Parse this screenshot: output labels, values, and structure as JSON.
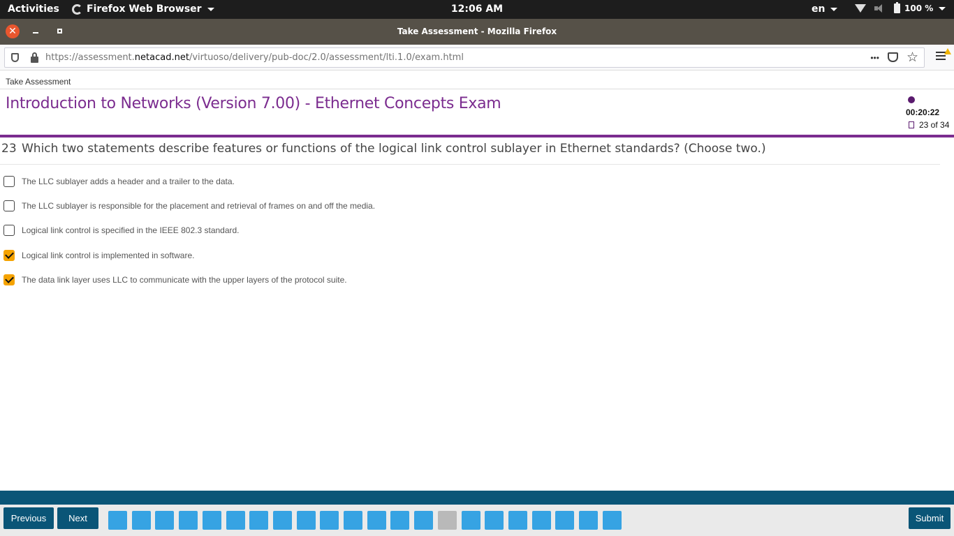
{
  "system_bar": {
    "activities": "Activities",
    "app_name": "Firefox Web Browser",
    "clock": "12:06 AM",
    "language": "en",
    "battery": "100 %"
  },
  "window": {
    "title": "Take Assessment - Mozilla Firefox"
  },
  "browser": {
    "url_prefix": "https://assessment.",
    "url_domain": "netacad.net",
    "url_path": "/virtuoso/delivery/pub-doc/2.0/assessment/lti.1.0/exam.html",
    "more_glyph": "•••",
    "bookmark_glyph": "☆"
  },
  "page": {
    "breadcrumb": "Take Assessment",
    "exam_title": "Introduction to Networks (Version 7.00) - Ethernet Concepts Exam",
    "timer": "00:20:22",
    "progress": "23 of 34"
  },
  "question": {
    "number": "23",
    "text": "Which two statements describe features or functions of the logical link control sublayer in Ethernet standards? (Choose two.)",
    "options": [
      {
        "label": "The LLC sublayer adds a header and a trailer to the data.",
        "checked": false
      },
      {
        "label": "The LLC sublayer is responsible for the placement and retrieval of frames on and off the media.",
        "checked": false
      },
      {
        "label": "Logical link control is specified in the IEEE 802.3 standard.",
        "checked": false
      },
      {
        "label": "Logical link control is implemented in software.",
        "checked": true
      },
      {
        "label": "The data link layer uses LLC to communicate with the upper layers of the protocol suite.",
        "checked": true
      }
    ]
  },
  "footer": {
    "previous": "Previous",
    "next": "Next",
    "submit": "Submit",
    "question_count": 22,
    "current_index": 14,
    "flagged_index": 22,
    "colors": {
      "answered": "#36a3e3",
      "current": "#b9b9b9",
      "flagged": "#7cc356"
    }
  }
}
